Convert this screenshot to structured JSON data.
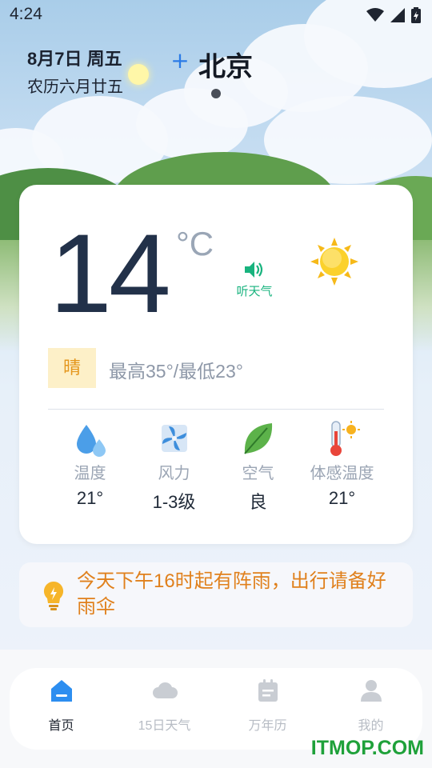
{
  "status_bar": {
    "time": "4:24"
  },
  "header": {
    "date": "8月7日 周五",
    "lunar_date": "农历六月廿五",
    "add_label": "+",
    "city": "北京"
  },
  "current": {
    "temperature": "14",
    "unit": "°C",
    "listen_label": "听天气",
    "condition": "晴",
    "range": "最高35°/最低23°"
  },
  "details": [
    {
      "label": "温度",
      "value": "21°",
      "icon": "humidity-drop-icon"
    },
    {
      "label": "风力",
      "value": "1-3级",
      "icon": "wind-fan-icon"
    },
    {
      "label": "空气",
      "value": "良",
      "icon": "leaf-icon"
    },
    {
      "label": "体感温度",
      "value": "21°",
      "icon": "thermometer-sun-icon"
    }
  ],
  "tip": {
    "text": "今天下午16时起有阵雨，出行请备好雨伞"
  },
  "nav": [
    {
      "label": "首页",
      "active": true,
      "icon": "home-icon"
    },
    {
      "label": "15日天气",
      "active": false,
      "icon": "cloud-icon"
    },
    {
      "label": "万年历",
      "active": false,
      "icon": "calendar-icon"
    },
    {
      "label": "我的",
      "active": false,
      "icon": "user-icon"
    }
  ],
  "watermark": "ITMOP.COM",
  "colors": {
    "accent_blue": "#2b7be6",
    "listen_green": "#18b37e",
    "condition_orange": "#e4961c",
    "tip_orange": "#e0801c",
    "watermark_green": "#1fa13a"
  }
}
